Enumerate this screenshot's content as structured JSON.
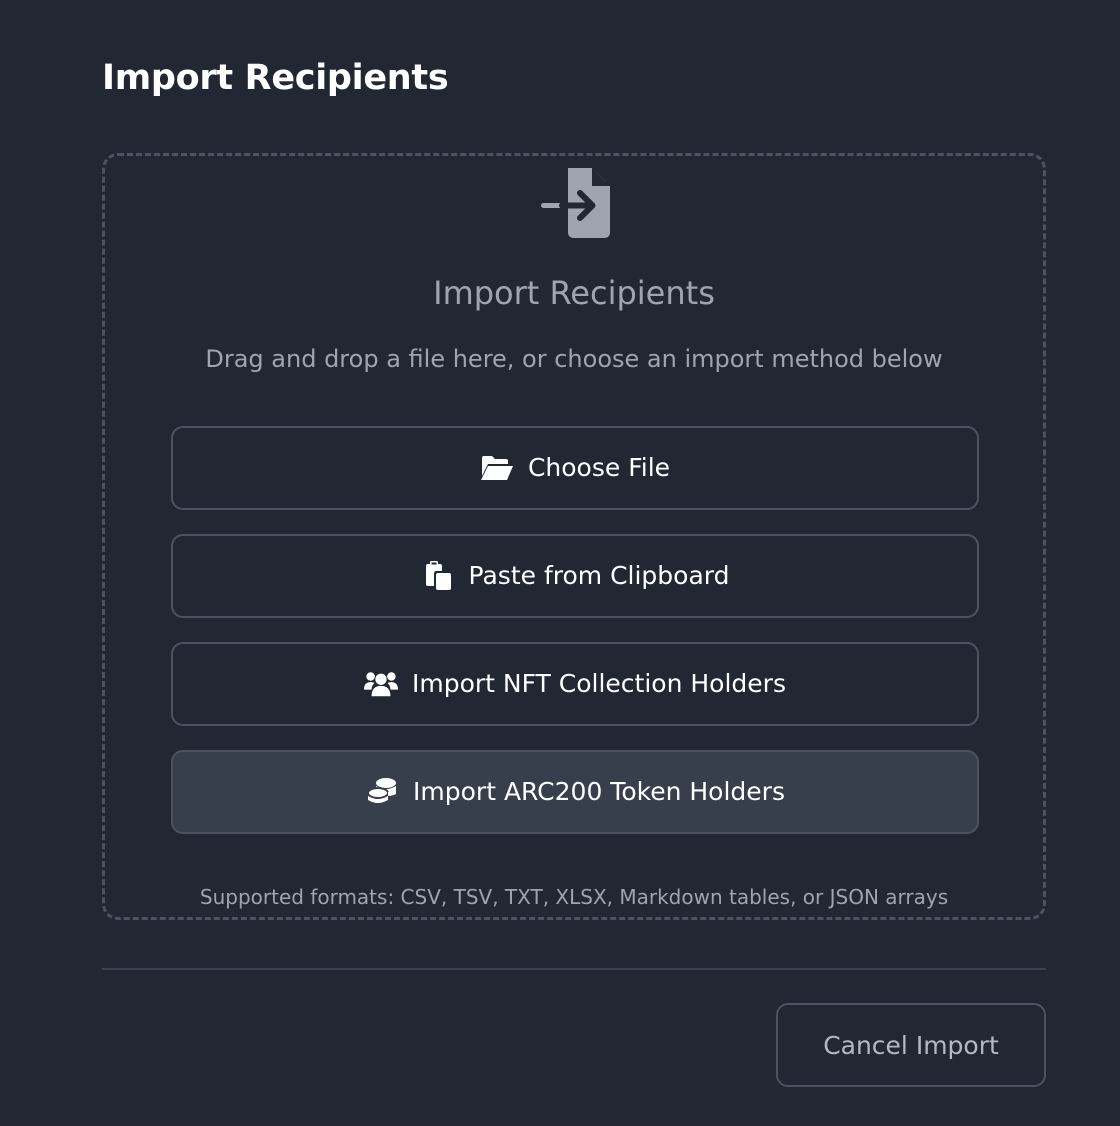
{
  "modal": {
    "title": "Import Recipients"
  },
  "dropzone": {
    "icon": "file-import-icon",
    "title": "Import Recipients",
    "subtitle": "Drag and drop a file here, or choose an import method below",
    "formats": "Supported formats: CSV, TSV, TXT, XLSX, Markdown tables, or JSON arrays"
  },
  "methods": [
    {
      "label": "Choose File",
      "icon": "folder-open-icon",
      "active": false
    },
    {
      "label": "Paste from Clipboard",
      "icon": "paste-icon",
      "active": false
    },
    {
      "label": "Import NFT Collection Holders",
      "icon": "users-icon",
      "active": false
    },
    {
      "label": "Import ARC200 Token Holders",
      "icon": "coins-icon",
      "active": true
    }
  ],
  "footer": {
    "cancel_label": "Cancel Import"
  },
  "colors": {
    "background": "#212733",
    "border": "#4b5262",
    "muted_text": "#9ea4b0",
    "active_button": "#373e4c"
  }
}
